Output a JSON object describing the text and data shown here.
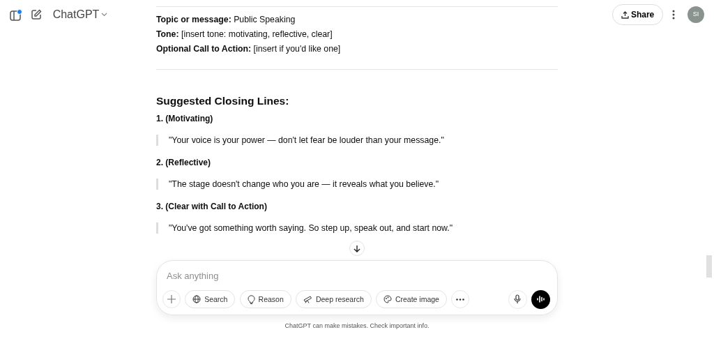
{
  "header": {
    "title": "ChatGPT",
    "notification_dot": true,
    "share": "Share",
    "avatar": "SI"
  },
  "details": [
    "**Topic or message:** Public Speaking",
    "**Tone:** [insert tone: motivating, reflective, clear]",
    "**Optional Call to Action:** [insert if you'd like one]"
  ],
  "section_title": "Suggested Closing Lines:",
  "suggestions": [
    {
      "title": "1. (Motivating)",
      "quote": "\"Your voice is your power — don't let fear be louder than your message.\""
    },
    {
      "title": "2. (Reflective)",
      "quote": "\"The stage doesn't change who you are — it reveals what you believe.\""
    },
    {
      "title": "3. (Clear with Call to Action)",
      "quote": "\"You've got something worth saying. So step up, speak out, and start now.\""
    }
  ],
  "composer": {
    "placeholder": "Ask anything",
    "tools": [
      {
        "label": "Search",
        "kind": "globe"
      },
      {
        "label": "Reason",
        "kind": "bulb"
      },
      {
        "label": "Deep research",
        "kind": "telescope"
      },
      {
        "label": "Create image",
        "kind": "palette"
      }
    ]
  },
  "footer": "ChatGPT can make mistakes. Check important info."
}
